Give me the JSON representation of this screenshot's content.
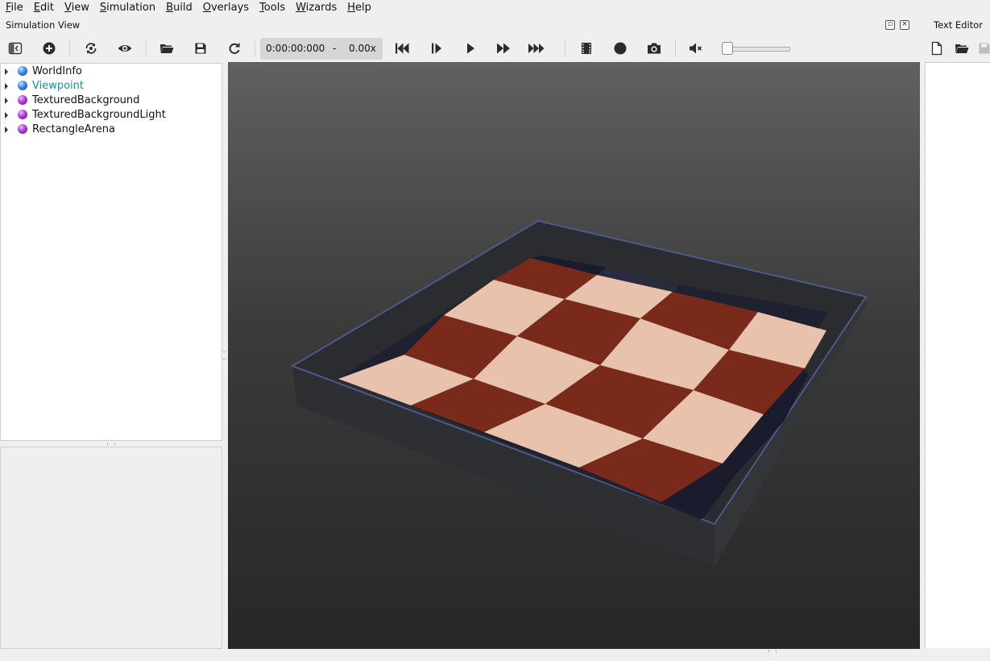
{
  "menu": [
    "File",
    "Edit",
    "View",
    "Simulation",
    "Build",
    "Overlays",
    "Tools",
    "Wizards",
    "Help"
  ],
  "panels": {
    "simulation_view_title": "Simulation View",
    "text_editor_title": "Text Editor"
  },
  "toolbar": {
    "time": "0:00:00:000",
    "separator": "-",
    "speed": "0.00x",
    "volume_level": 0
  },
  "toolbar_icons": [
    "toggle-scene-tree-icon",
    "add-node-icon",
    "reset-view-icon",
    "show-icon",
    "open-world-icon",
    "save-world-icon",
    "reload-world-icon",
    "first-step-icon",
    "step-icon",
    "play-icon",
    "fast-forward-icon",
    "fastest-icon",
    "record-movie-icon",
    "record-animation-icon",
    "screenshot-icon",
    "mute-icon",
    "new-file-icon",
    "open-file-icon",
    "save-file-icon"
  ],
  "scene_tree": [
    {
      "label": "WorldInfo",
      "ball": "blue",
      "color": "#111111"
    },
    {
      "label": "Viewpoint",
      "ball": "blue",
      "color": "#1a8f9a"
    },
    {
      "label": "TexturedBackground",
      "ball": "purple",
      "color": "#111111"
    },
    {
      "label": "TexturedBackgroundLight",
      "ball": "purple",
      "color": "#111111"
    },
    {
      "label": "RectangleArena",
      "ball": "purple",
      "color": "#111111"
    }
  ],
  "colors": {
    "viewpoint_text": "#1a8f9a",
    "floor_light": "#e8c2ad",
    "floor_dark": "#7a2a1a",
    "wall": "#3a3b3e",
    "wall_edge": "#4a5a8a"
  }
}
